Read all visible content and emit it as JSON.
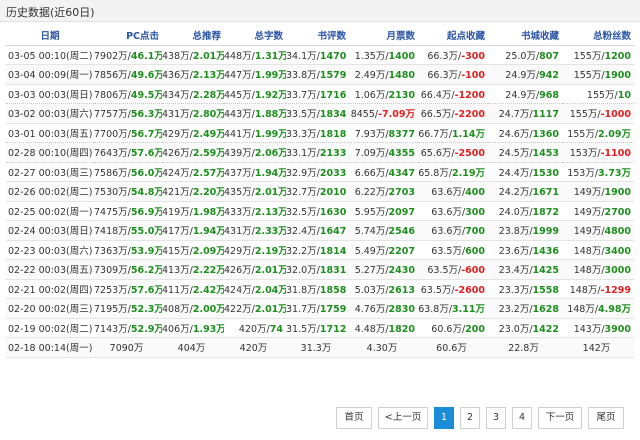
{
  "header": {
    "title": "历史数据(近60日)"
  },
  "table": {
    "columns": [
      "日期",
      "PC点击",
      "总推荐",
      "总字数",
      "书评数",
      "月票数",
      "起点收藏",
      "书城收藏",
      "总粉丝数"
    ],
    "rows": [
      [
        {
          "d": "03-05 00:10(周二)"
        },
        {
          "b": "7902万/",
          "v": "46.1万",
          "c": "g"
        },
        {
          "b": "438万/",
          "v": "2.01万",
          "c": "g"
        },
        {
          "b": "448万/",
          "v": "1.31万",
          "c": "g"
        },
        {
          "b": "34.1万/",
          "v": "1470",
          "c": "g"
        },
        {
          "b": "1.35万/",
          "v": "1400",
          "c": "g"
        },
        {
          "b": "66.3万/",
          "v": "-300",
          "c": "r"
        },
        {
          "b": "25.0万/",
          "v": "807",
          "c": "g"
        },
        {
          "b": "155万/",
          "v": "1200",
          "c": "g"
        }
      ],
      [
        {
          "d": "03-04 00:09(周一)"
        },
        {
          "b": "7856万/",
          "v": "49.6万",
          "c": "g"
        },
        {
          "b": "436万/",
          "v": "2.13万",
          "c": "g"
        },
        {
          "b": "447万/",
          "v": "1.99万",
          "c": "g"
        },
        {
          "b": "33.8万/",
          "v": "1579",
          "c": "g"
        },
        {
          "b": "2.49万/",
          "v": "1480",
          "c": "g"
        },
        {
          "b": "66.3万/",
          "v": "-100",
          "c": "r"
        },
        {
          "b": "24.9万/",
          "v": "942",
          "c": "g"
        },
        {
          "b": "155万/",
          "v": "1900",
          "c": "g"
        }
      ],
      [
        {
          "d": "03-03 00:03(周日)"
        },
        {
          "b": "7806万/",
          "v": "49.5万",
          "c": "g"
        },
        {
          "b": "434万/",
          "v": "2.28万",
          "c": "g"
        },
        {
          "b": "445万/",
          "v": "1.92万",
          "c": "g"
        },
        {
          "b": "33.7万/",
          "v": "1716",
          "c": "g"
        },
        {
          "b": "1.06万/",
          "v": "2130",
          "c": "g"
        },
        {
          "b": "66.4万/",
          "v": "-1200",
          "c": "r"
        },
        {
          "b": "24.9万/",
          "v": "968",
          "c": "g"
        },
        {
          "b": "155万/",
          "v": "10",
          "c": "g"
        }
      ],
      [
        {
          "d": "03-02 00:03(周六)"
        },
        {
          "b": "7757万/",
          "v": "56.3万",
          "c": "g"
        },
        {
          "b": "431万/",
          "v": "2.80万",
          "c": "g"
        },
        {
          "b": "443万/",
          "v": "1.88万",
          "c": "g"
        },
        {
          "b": "33.5万/",
          "v": "1834",
          "c": "g"
        },
        {
          "b": "8455/",
          "v": "-7.09万",
          "c": "r"
        },
        {
          "b": "66.5万/",
          "v": "-2200",
          "c": "r"
        },
        {
          "b": "24.7万/",
          "v": "1117",
          "c": "g"
        },
        {
          "b": "155万/",
          "v": "-1000",
          "c": "r"
        }
      ],
      [
        {
          "d": "03-01 00:03(周五)"
        },
        {
          "b": "7700万/",
          "v": "56.7万",
          "c": "g"
        },
        {
          "b": "429万/",
          "v": "2.49万",
          "c": "g"
        },
        {
          "b": "441万/",
          "v": "1.99万",
          "c": "g"
        },
        {
          "b": "33.3万/",
          "v": "1818",
          "c": "g"
        },
        {
          "b": "7.93万/",
          "v": "8377",
          "c": "g"
        },
        {
          "b": "66.7万/",
          "v": "1.14万",
          "c": "g"
        },
        {
          "b": "24.6万/",
          "v": "1360",
          "c": "g"
        },
        {
          "b": "155万/",
          "v": "2.09万",
          "c": "g"
        }
      ],
      [
        {
          "d": "02-28 00:10(周四)"
        },
        {
          "b": "7643万/",
          "v": "57.6万",
          "c": "g"
        },
        {
          "b": "426万/",
          "v": "2.59万",
          "c": "g"
        },
        {
          "b": "439万/",
          "v": "2.06万",
          "c": "g"
        },
        {
          "b": "33.1万/",
          "v": "2133",
          "c": "g"
        },
        {
          "b": "7.09万/",
          "v": "4355",
          "c": "g"
        },
        {
          "b": "65.6万/",
          "v": "-2500",
          "c": "r"
        },
        {
          "b": "24.5万/",
          "v": "1453",
          "c": "g"
        },
        {
          "b": "153万/",
          "v": "-1100",
          "c": "r"
        }
      ],
      [
        {
          "d": "02-27 00:03(周三)"
        },
        {
          "b": "7586万/",
          "v": "56.0万",
          "c": "g"
        },
        {
          "b": "424万/",
          "v": "2.57万",
          "c": "g"
        },
        {
          "b": "437万/",
          "v": "1.94万",
          "c": "g"
        },
        {
          "b": "32.9万/",
          "v": "2033",
          "c": "g"
        },
        {
          "b": "6.66万/",
          "v": "4347",
          "c": "g"
        },
        {
          "b": "65.8万/",
          "v": "2.19万",
          "c": "g"
        },
        {
          "b": "24.4万/",
          "v": "1530",
          "c": "g"
        },
        {
          "b": "153万/",
          "v": "3.73万",
          "c": "g"
        }
      ],
      [
        {
          "d": "02-26 00:02(周二)"
        },
        {
          "b": "7530万/",
          "v": "54.8万",
          "c": "g"
        },
        {
          "b": "421万/",
          "v": "2.20万",
          "c": "g"
        },
        {
          "b": "435万/",
          "v": "2.01万",
          "c": "g"
        },
        {
          "b": "32.7万/",
          "v": "2010",
          "c": "g"
        },
        {
          "b": "6.22万/",
          "v": "2703",
          "c": "g"
        },
        {
          "b": "63.6万/",
          "v": "400",
          "c": "g"
        },
        {
          "b": "24.2万/",
          "v": "1671",
          "c": "g"
        },
        {
          "b": "149万/",
          "v": "1900",
          "c": "g"
        }
      ],
      [
        {
          "d": "02-25 00:02(周一)"
        },
        {
          "b": "7475万/",
          "v": "56.9万",
          "c": "g"
        },
        {
          "b": "419万/",
          "v": "1.98万",
          "c": "g"
        },
        {
          "b": "433万/",
          "v": "2.13万",
          "c": "g"
        },
        {
          "b": "32.5万/",
          "v": "1630",
          "c": "g"
        },
        {
          "b": "5.95万/",
          "v": "2097",
          "c": "g"
        },
        {
          "b": "63.6万/",
          "v": "300",
          "c": "g"
        },
        {
          "b": "24.0万/",
          "v": "1872",
          "c": "g"
        },
        {
          "b": "149万/",
          "v": "2700",
          "c": "g"
        }
      ],
      [
        {
          "d": "02-24 00:03(周日)"
        },
        {
          "b": "7418万/",
          "v": "55.0万",
          "c": "g"
        },
        {
          "b": "417万/",
          "v": "1.94万",
          "c": "g"
        },
        {
          "b": "431万/",
          "v": "2.33万",
          "c": "g"
        },
        {
          "b": "32.4万/",
          "v": "1647",
          "c": "g"
        },
        {
          "b": "5.74万/",
          "v": "2546",
          "c": "g"
        },
        {
          "b": "63.6万/",
          "v": "700",
          "c": "g"
        },
        {
          "b": "23.8万/",
          "v": "1999",
          "c": "g"
        },
        {
          "b": "149万/",
          "v": "4800",
          "c": "g"
        }
      ],
      [
        {
          "d": "02-23 00:03(周六)"
        },
        {
          "b": "7363万/",
          "v": "53.9万",
          "c": "g"
        },
        {
          "b": "415万/",
          "v": "2.09万",
          "c": "g"
        },
        {
          "b": "429万/",
          "v": "2.19万",
          "c": "g"
        },
        {
          "b": "32.2万/",
          "v": "1814",
          "c": "g"
        },
        {
          "b": "5.49万/",
          "v": "2207",
          "c": "g"
        },
        {
          "b": "63.5万/",
          "v": "600",
          "c": "g"
        },
        {
          "b": "23.6万/",
          "v": "1436",
          "c": "g"
        },
        {
          "b": "148万/",
          "v": "3400",
          "c": "g"
        }
      ],
      [
        {
          "d": "02-22 00:03(周五)"
        },
        {
          "b": "7309万/",
          "v": "56.2万",
          "c": "g"
        },
        {
          "b": "413万/",
          "v": "2.22万",
          "c": "g"
        },
        {
          "b": "426万/",
          "v": "2.01万",
          "c": "g"
        },
        {
          "b": "32.0万/",
          "v": "1831",
          "c": "g"
        },
        {
          "b": "5.27万/",
          "v": "2430",
          "c": "g"
        },
        {
          "b": "63.5万/",
          "v": "-600",
          "c": "r"
        },
        {
          "b": "23.4万/",
          "v": "1425",
          "c": "g"
        },
        {
          "b": "148万/",
          "v": "3000",
          "c": "g"
        }
      ],
      [
        {
          "d": "02-21 00:02(周四)"
        },
        {
          "b": "7253万/",
          "v": "57.6万",
          "c": "g"
        },
        {
          "b": "411万/",
          "v": "2.42万",
          "c": "g"
        },
        {
          "b": "424万/",
          "v": "2.04万",
          "c": "g"
        },
        {
          "b": "31.8万/",
          "v": "1858",
          "c": "g"
        },
        {
          "b": "5.03万/",
          "v": "2613",
          "c": "g"
        },
        {
          "b": "63.5万/",
          "v": "-2600",
          "c": "r"
        },
        {
          "b": "23.3万/",
          "v": "1558",
          "c": "g"
        },
        {
          "b": "148万/",
          "v": "-1299",
          "c": "r"
        }
      ],
      [
        {
          "d": "02-20 00:02(周三)"
        },
        {
          "b": "7195万/",
          "v": "52.3万",
          "c": "g"
        },
        {
          "b": "408万/",
          "v": "2.00万",
          "c": "g"
        },
        {
          "b": "422万/",
          "v": "2.01万",
          "c": "g"
        },
        {
          "b": "31.7万/",
          "v": "1759",
          "c": "g"
        },
        {
          "b": "4.76万/",
          "v": "2830",
          "c": "g"
        },
        {
          "b": "63.8万/",
          "v": "3.11万",
          "c": "g"
        },
        {
          "b": "23.2万/",
          "v": "1628",
          "c": "g"
        },
        {
          "b": "148万/",
          "v": "4.98万",
          "c": "g"
        }
      ],
      [
        {
          "d": "02-19 00:02(周二)"
        },
        {
          "b": "7143万/",
          "v": "52.9万",
          "c": "g"
        },
        {
          "b": "406万/",
          "v": "1.93万",
          "c": "g"
        },
        {
          "b": "420万/",
          "v": "74",
          "c": "g"
        },
        {
          "b": "31.5万/",
          "v": "1712",
          "c": "g"
        },
        {
          "b": "4.48万/",
          "v": "1820",
          "c": "g"
        },
        {
          "b": "60.6万/",
          "v": "200",
          "c": "g"
        },
        {
          "b": "23.0万/",
          "v": "1422",
          "c": "g"
        },
        {
          "b": "143万/",
          "v": "3900",
          "c": "g"
        }
      ],
      [
        {
          "d": "02-18 00:14(周一)"
        },
        {
          "b": "7090万"
        },
        {
          "b": "404万"
        },
        {
          "b": "420万"
        },
        {
          "b": "31.3万"
        },
        {
          "b": "4.30万"
        },
        {
          "b": "60.6万"
        },
        {
          "b": "22.8万"
        },
        {
          "b": "142万"
        }
      ]
    ]
  },
  "pagination": {
    "first": "首页",
    "prev": "<上一页",
    "pages": [
      "1",
      "2",
      "3",
      "4"
    ],
    "current": "1",
    "next": "下一页",
    "last": "尾页"
  },
  "colors": {
    "accent": "#1a8cd8",
    "positive": "#1e8f1e",
    "negative": "#e02020",
    "header_text": "#2b55a6"
  }
}
